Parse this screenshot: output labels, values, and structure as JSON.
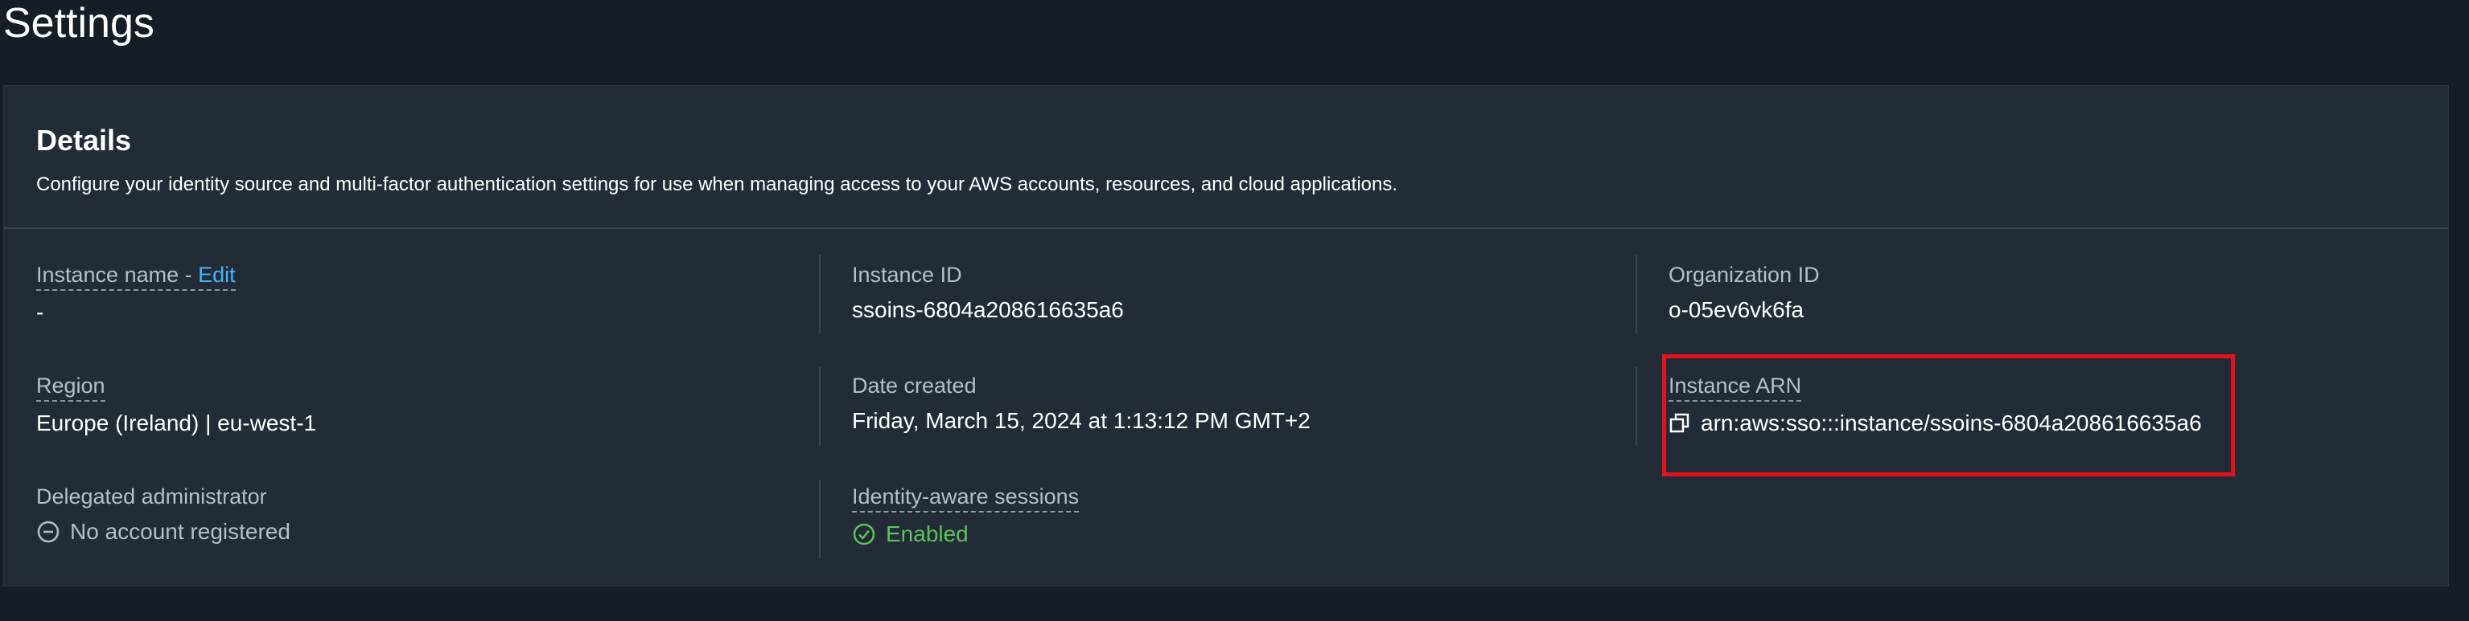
{
  "page": {
    "title": "Settings"
  },
  "details": {
    "title": "Details",
    "description": "Configure your identity source and multi-factor authentication settings for use when managing access to your AWS accounts, resources, and cloud applications.",
    "instance_name": {
      "label": "Instance name - ",
      "edit_label": "Edit",
      "value": "-"
    },
    "instance_id": {
      "label": "Instance ID",
      "value": "ssoins-6804a208616635a6"
    },
    "organization_id": {
      "label": "Organization ID",
      "value": "o-05ev6vk6fa"
    },
    "region": {
      "label": "Region",
      "value": "Europe (Ireland) | eu-west-1"
    },
    "date_created": {
      "label": "Date created",
      "value": "Friday, March 15, 2024 at 1:13:12 PM GMT+2"
    },
    "instance_arn": {
      "label": "Instance ARN",
      "value": "arn:aws:sso:::instance/ssoins-6804a208616635a6",
      "icon": "copy-icon"
    },
    "delegated_admin": {
      "label": "Delegated administrator",
      "value": "No account registered",
      "icon": "minus-circle-icon"
    },
    "identity_sessions": {
      "label": "Identity-aware sessions",
      "value": "Enabled",
      "icon": "check-circle-icon"
    }
  },
  "colors": {
    "background": "#161d26",
    "panel": "#232b37",
    "label": "#b6bec9",
    "link": "#42b4ff",
    "success": "#5ac45a",
    "highlight": "#e2141b"
  }
}
